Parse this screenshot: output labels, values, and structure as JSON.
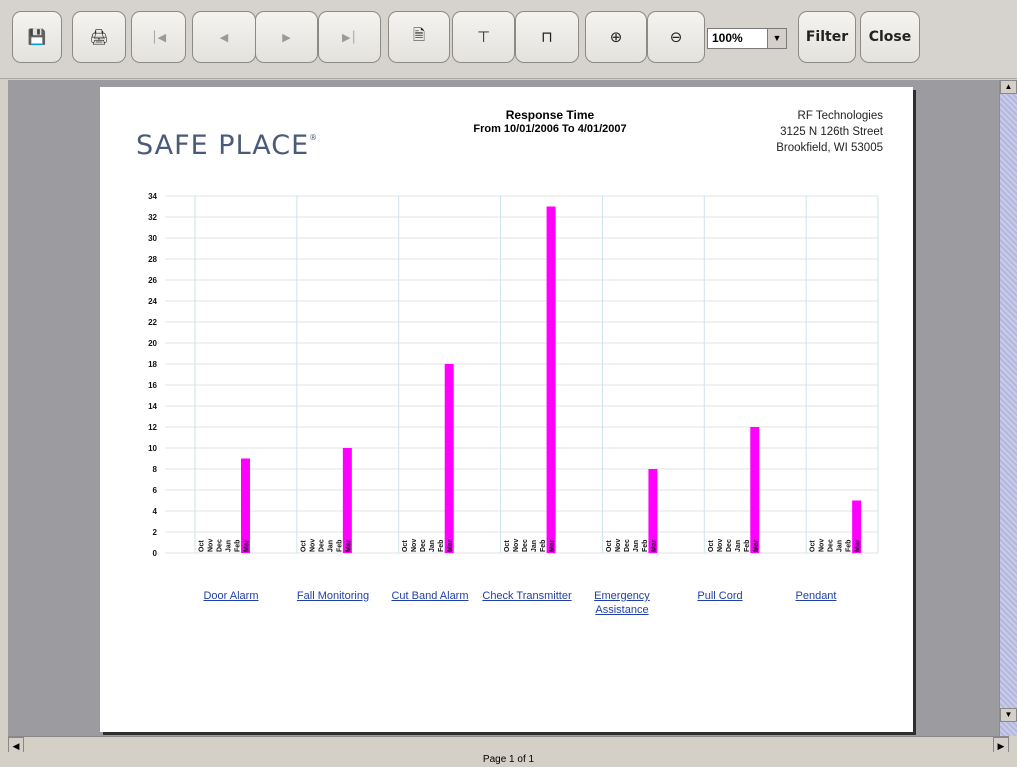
{
  "toolbar": {
    "zoom_value": "100%",
    "filter_label": "Filter",
    "close_label": "Close"
  },
  "report": {
    "logo_text": "SAFE PLACE",
    "logo_mark": "®",
    "title": "Response Time",
    "subtitle": "From 10/01/2006 To 4/01/2007",
    "company": "RF Technologies",
    "address1": "3125 N 126th Street",
    "address2": "Brookfield, WI 53005"
  },
  "status": {
    "page_label": "Page 1 of 1"
  },
  "chart_data": {
    "type": "bar",
    "title": "Response Time",
    "ylim": [
      0,
      34
    ],
    "yticks": [
      0,
      2,
      4,
      6,
      8,
      10,
      12,
      14,
      16,
      18,
      20,
      22,
      24,
      26,
      28,
      30,
      32,
      34
    ],
    "months": [
      "Oct",
      "Nov",
      "Dec",
      "Jan",
      "Feb",
      "Mar"
    ],
    "bar_color": "#ff00ff",
    "groups": [
      {
        "category": "Door Alarm",
        "values": [
          0,
          0,
          0,
          0,
          0,
          9
        ]
      },
      {
        "category": "Fall Monitoring",
        "values": [
          0,
          0,
          0,
          0,
          0,
          10
        ]
      },
      {
        "category": "Cut Band Alarm",
        "values": [
          0,
          0,
          0,
          0,
          0,
          18
        ]
      },
      {
        "category": "Check Transmitter",
        "values": [
          0,
          0,
          0,
          0,
          0,
          33
        ]
      },
      {
        "category": "Emergency Assistance",
        "values": [
          0,
          0,
          0,
          0,
          0,
          8
        ]
      },
      {
        "category": "Pull Cord",
        "values": [
          0,
          0,
          0,
          0,
          0,
          12
        ]
      },
      {
        "category": "Pendant",
        "values": [
          0,
          0,
          0,
          0,
          0,
          5
        ]
      }
    ]
  }
}
